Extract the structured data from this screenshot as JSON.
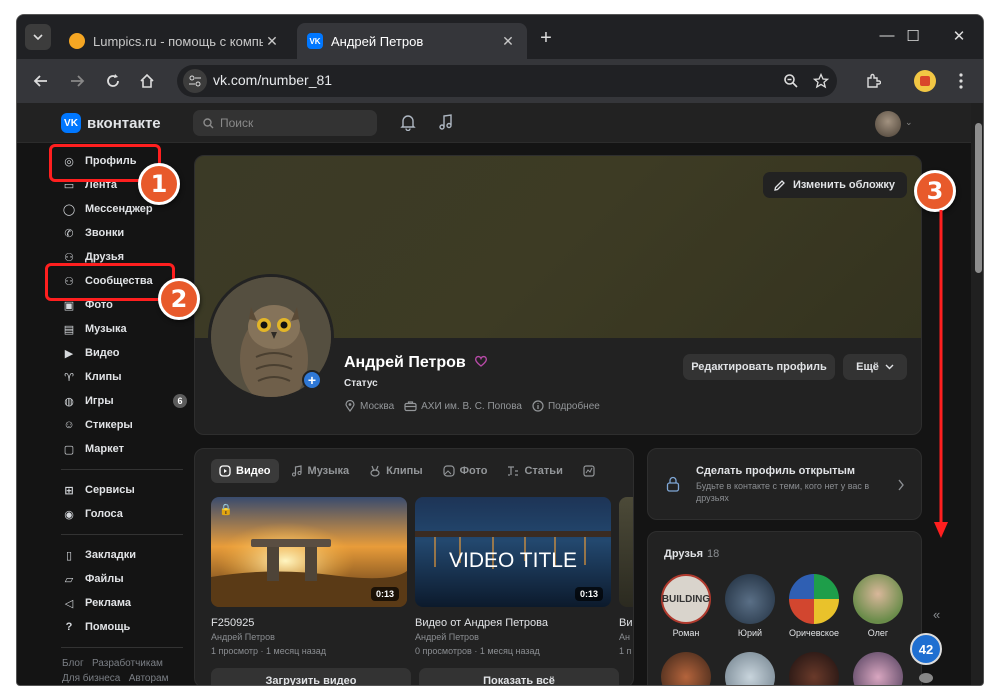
{
  "browser": {
    "tabs": [
      {
        "title": "Lumpics.ru - помощь с компью",
        "favicon_color": "#f5a623"
      },
      {
        "title": "Андрей Петров",
        "favicon_color": "#0077ff"
      }
    ],
    "new_tab": "+",
    "url": "vk.com/number_81"
  },
  "vk": {
    "logo_text": "вконтакте",
    "logo_mark": "VK",
    "search_placeholder": "Поиск",
    "nav": [
      {
        "label": "Профиль",
        "icon": "user-circle-icon"
      },
      {
        "label": "Лента",
        "icon": "feed-icon"
      },
      {
        "label": "Мессенджер",
        "icon": "message-icon"
      },
      {
        "label": "Звонки",
        "icon": "phone-icon"
      },
      {
        "label": "Друзья",
        "icon": "friends-icon"
      },
      {
        "label": "Сообщества",
        "icon": "communities-icon"
      },
      {
        "label": "Фото",
        "icon": "photo-icon"
      },
      {
        "label": "Музыка",
        "icon": "music-icon"
      },
      {
        "label": "Видео",
        "icon": "video-icon"
      },
      {
        "label": "Клипы",
        "icon": "clips-icon"
      },
      {
        "label": "Игры",
        "icon": "gamepad-icon",
        "count": "6"
      },
      {
        "label": "Стикеры",
        "icon": "sticker-icon"
      },
      {
        "label": "Маркет",
        "icon": "market-icon"
      }
    ],
    "nav2": [
      {
        "label": "Сервисы",
        "icon": "services-icon"
      },
      {
        "label": "Голоса",
        "icon": "coins-icon"
      }
    ],
    "nav3": [
      {
        "label": "Закладки",
        "icon": "bookmark-icon"
      },
      {
        "label": "Файлы",
        "icon": "file-icon"
      },
      {
        "label": "Реклама",
        "icon": "megaphone-icon"
      },
      {
        "label": "Помощь",
        "icon": "help-icon"
      }
    ],
    "footer": [
      "Блог",
      "Разработчикам",
      "Для бизнеса",
      "Авторам"
    ]
  },
  "profile": {
    "change_cover": "Изменить обложку",
    "name": "Андрей Петров",
    "status": "Статус",
    "city": "Москва",
    "work": "АХИ им. В. С. Попова",
    "details": "Подробнее",
    "edit_profile": "Редактировать профиль",
    "more": "Ещё"
  },
  "media": {
    "tabs": [
      "Видео",
      "Музыка",
      "Клипы",
      "Фото",
      "Статьи"
    ],
    "videos": [
      {
        "title": "F250925",
        "author": "Андрей Петров",
        "views": "1 просмотр",
        "age": "1 месяц назад",
        "duration": "0:13"
      },
      {
        "title": "Видео от Андрея Петрова",
        "author": "Андрей Петров",
        "views": "0 просмотров",
        "age": "1 месяц назад",
        "duration": "0:13",
        "overlay": "VIDEO TITLE"
      },
      {
        "title": "Ви",
        "author": "Ан",
        "views": "1 п",
        "age": ""
      }
    ],
    "upload": "Загрузить видео",
    "show_all": "Показать всё"
  },
  "open_profile": {
    "title": "Сделать профиль открытым",
    "desc": "Будьте в контакте с теми, кого нет у вас в друзьях"
  },
  "friends": {
    "title": "Друзья",
    "count": "18",
    "list": [
      "Роман",
      "Юрий",
      "Оричевское",
      "Олег"
    ],
    "building_text": "BUILDING",
    "side_badge": "42"
  },
  "annotations": [
    "1",
    "2",
    "3"
  ]
}
